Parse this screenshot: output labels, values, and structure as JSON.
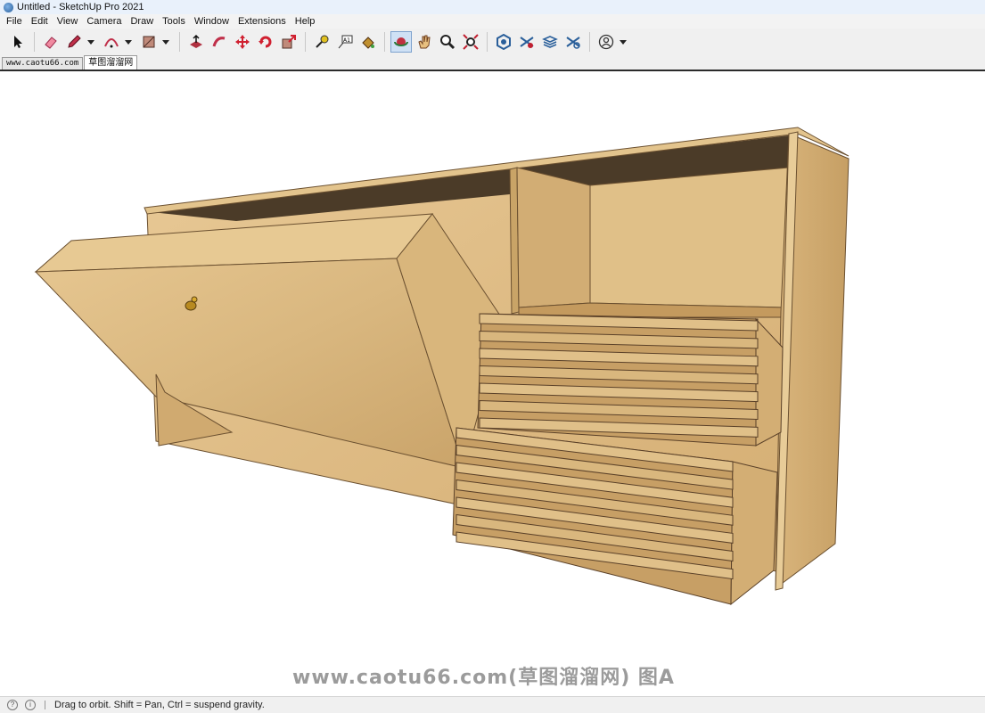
{
  "window": {
    "title": "Untitled - SketchUp Pro 2021"
  },
  "menu": [
    "File",
    "Edit",
    "View",
    "Camera",
    "Draw",
    "Tools",
    "Window",
    "Extensions",
    "Help"
  ],
  "toolbar": {
    "tools": [
      {
        "name": "select-tool",
        "icon": "arrow-cursor-icon"
      },
      {
        "name": "eraser-tool",
        "icon": "eraser-icon"
      },
      {
        "name": "pencil-tool",
        "icon": "pencil-icon"
      },
      {
        "name": "arc-tool",
        "icon": "arc-icon"
      },
      {
        "name": "rectangle-tool",
        "icon": "rectangle-icon"
      },
      {
        "name": "push-pull-tool",
        "icon": "push-pull-icon"
      },
      {
        "name": "follow-me-tool",
        "icon": "follow-me-icon"
      },
      {
        "name": "move-tool",
        "icon": "move-icon"
      },
      {
        "name": "rotate-tool",
        "icon": "rotate-icon"
      },
      {
        "name": "scale-tool",
        "icon": "scale-icon"
      },
      {
        "name": "tape-measure-tool",
        "icon": "tape-measure-icon"
      },
      {
        "name": "text-tool",
        "icon": "text-icon"
      },
      {
        "name": "paint-bucket-tool",
        "icon": "paint-bucket-icon"
      },
      {
        "name": "orbit-tool",
        "icon": "orbit-icon"
      },
      {
        "name": "pan-tool",
        "icon": "hand-icon"
      },
      {
        "name": "zoom-tool",
        "icon": "magnifier-icon"
      },
      {
        "name": "zoom-extents-tool",
        "icon": "zoom-extents-icon"
      },
      {
        "name": "3d-warehouse",
        "icon": "warehouse-icon"
      },
      {
        "name": "extension-warehouse",
        "icon": "extension-warehouse-icon"
      },
      {
        "name": "layout-send",
        "icon": "layers-icon"
      },
      {
        "name": "extension-manager",
        "icon": "extension-manager-icon"
      },
      {
        "name": "account",
        "icon": "user-icon"
      }
    ],
    "active_tool": "orbit-tool"
  },
  "scene_tabs": [
    "www.caotu66.com",
    "草图溜溜网"
  ],
  "viewport": {
    "watermark": "www.caotu66.com(草图溜溜网) 图A"
  },
  "status": {
    "message": "Drag to orbit. Shift = Pan, Ctrl = suspend gravity."
  },
  "colors": {
    "wood_light": "#e2c38f",
    "wood_mid": "#d6b37b",
    "wood_dark": "#c49a5e",
    "interior_dark": "#4a3a28"
  }
}
